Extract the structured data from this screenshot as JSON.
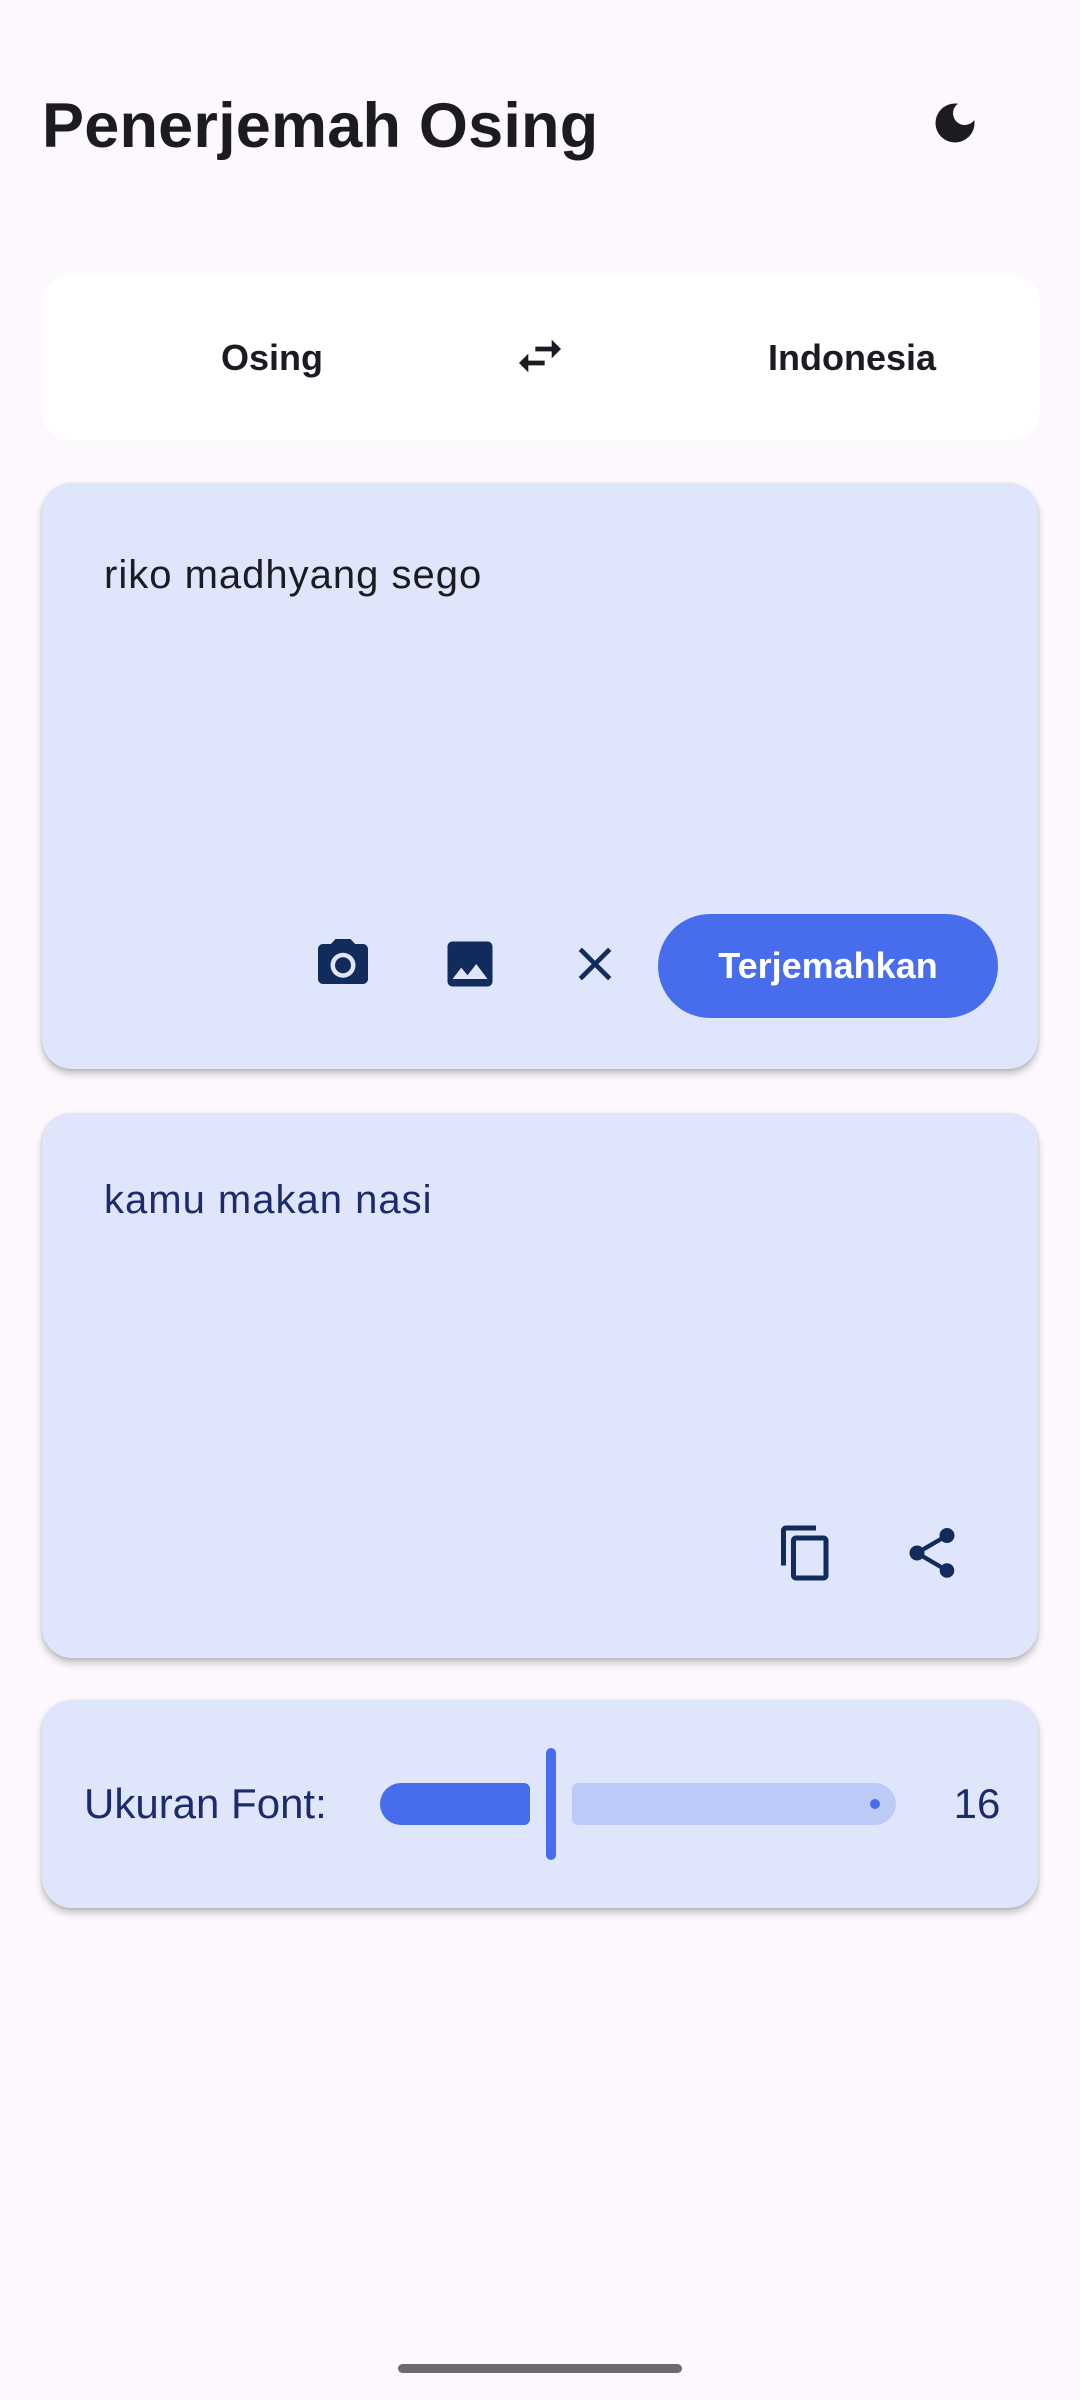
{
  "app": {
    "title": "Penerjemah Osing",
    "theme_icon": "moon-icon"
  },
  "languages": {
    "source": "Osing",
    "target": "Indonesia",
    "swap_icon": "swap-arrows-icon"
  },
  "input": {
    "text": "riko madhyang sego",
    "camera_icon": "camera-icon",
    "image_icon": "image-icon",
    "clear_icon": "close-icon",
    "translate_label": "Terjemahkan"
  },
  "output": {
    "text": "kamu makan nasi",
    "copy_icon": "copy-icon",
    "share_icon": "share-icon"
  },
  "font_size": {
    "label": "Ukuran Font:",
    "value": "16",
    "level_fraction": 0.25
  },
  "colors": {
    "background": "#fcf8fd",
    "card": "#dfe5fb",
    "accent": "#476ded",
    "accent_light": "#bccaf7",
    "icon_dark": "#102b5c"
  }
}
